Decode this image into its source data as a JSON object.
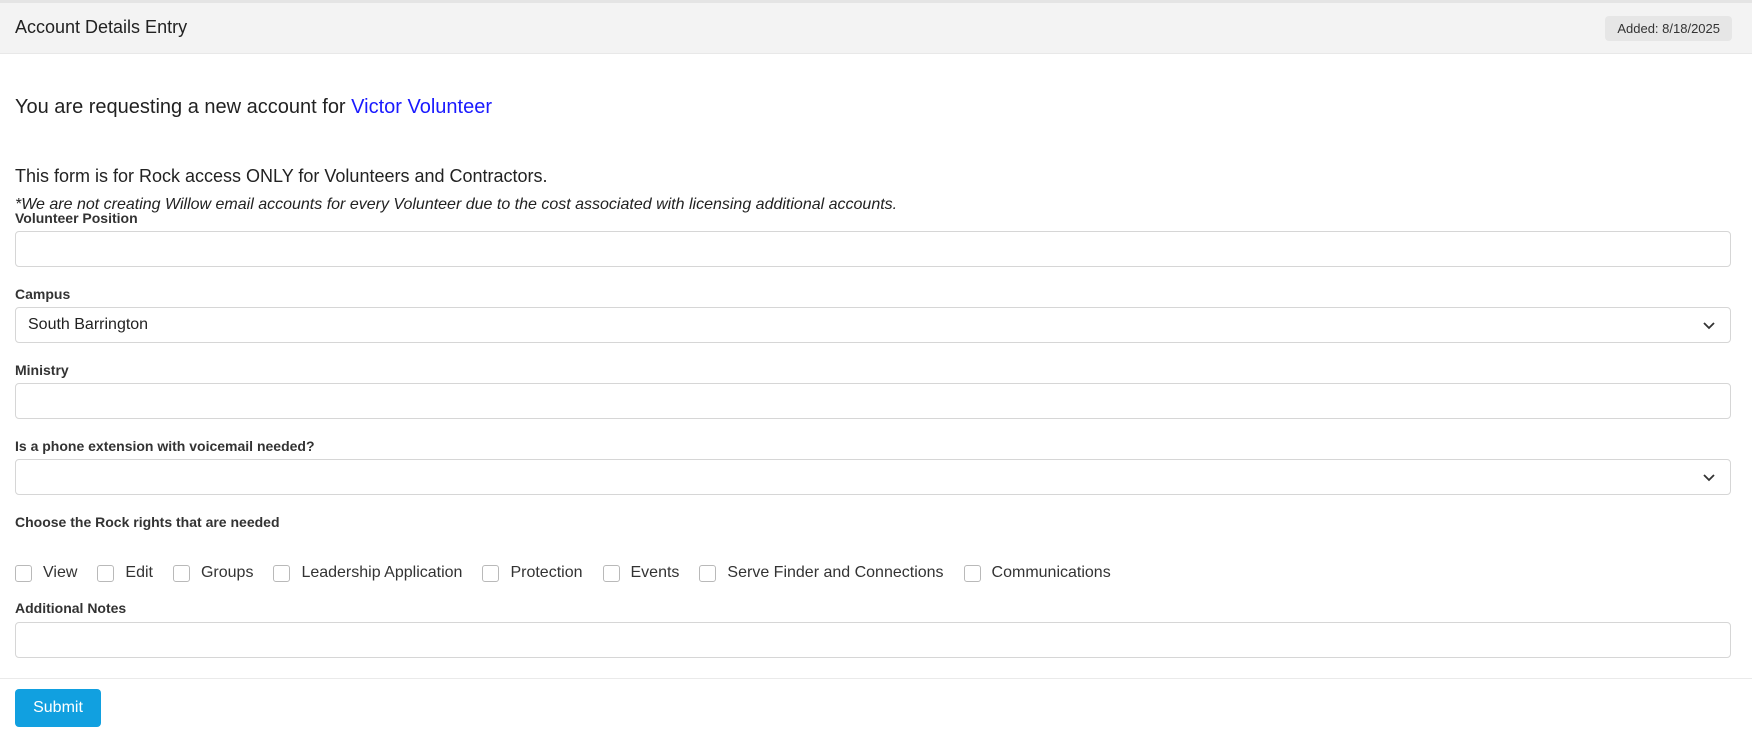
{
  "header": {
    "title": "Account Details Entry",
    "added_badge": "Added: 8/18/2025"
  },
  "request": {
    "prefix": "You are requesting a new account for ",
    "person_name": "Victor Volunteer"
  },
  "notice": {
    "main": "This form is for Rock access ONLY for Volunteers and Contractors.",
    "italic": "*We are not creating Willow email accounts for every Volunteer due to the cost associated with licensing additional accounts."
  },
  "fields": {
    "volunteer_position": {
      "label": "Volunteer Position",
      "value": ""
    },
    "campus": {
      "label": "Campus",
      "value": "South Barrington"
    },
    "ministry": {
      "label": "Ministry",
      "value": ""
    },
    "phone_extension": {
      "label": "Is a phone extension with voicemail needed?",
      "value": ""
    },
    "rock_rights": {
      "label": "Choose the Rock rights that are needed",
      "options": [
        "View",
        "Edit",
        "Groups",
        "Leadership Application",
        "Protection",
        "Events",
        "Serve Finder and Connections",
        "Communications"
      ]
    },
    "additional_notes": {
      "label": "Additional Notes",
      "value": ""
    }
  },
  "actions": {
    "submit_label": "Submit"
  },
  "colors": {
    "link": "#1a1aff",
    "submit": "#11a0e0",
    "header_bg": "#f3f3f3"
  },
  "icons": {
    "select_arrow": "chevron-down-icon"
  }
}
